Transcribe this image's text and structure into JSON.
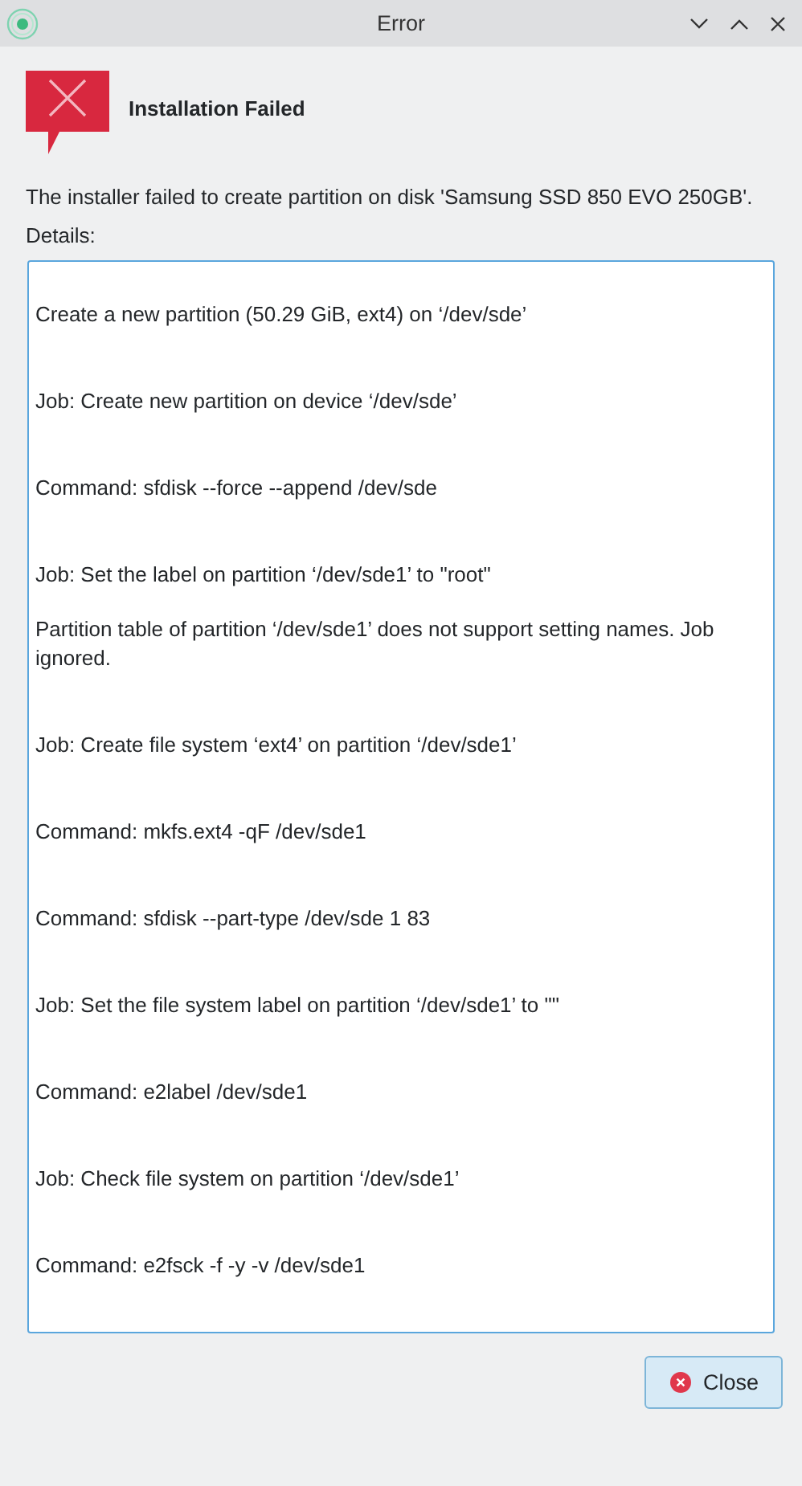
{
  "window": {
    "title": "Error"
  },
  "heading": "Installation Failed",
  "message": "The installer failed to create partition on disk 'Samsung SSD 850 EVO 250GB'.",
  "details_label": "Details:",
  "details": [
    {
      "kind": "step",
      "text": "Create a new partition (50.29 GiB, ext4) on ‘/dev/sde’"
    },
    {
      "kind": "step",
      "text": "Job: Create new partition on device ‘/dev/sde’"
    },
    {
      "kind": "step",
      "text": "Command: sfdisk --force --append /dev/sde"
    },
    {
      "kind": "step",
      "text": "Job: Set the label on partition ‘/dev/sde1’ to \"root\""
    },
    {
      "kind": "note",
      "text": "Partition table of partition ‘/dev/sde1’ does not support setting names. Job ignored."
    },
    {
      "kind": "step",
      "text": "Job: Create file system ‘ext4’ on partition ‘/dev/sde1’"
    },
    {
      "kind": "step",
      "text": "Command: mkfs.ext4 -qF /dev/sde1"
    },
    {
      "kind": "step",
      "text": "Command: sfdisk --part-type /dev/sde 1 83"
    },
    {
      "kind": "step",
      "text": "Job: Set the file system label on partition ‘/dev/sde1’ to \"\""
    },
    {
      "kind": "step",
      "text": "Command: e2label /dev/sde1"
    },
    {
      "kind": "step",
      "text": "Job: Check file system on partition ‘/dev/sde1’"
    },
    {
      "kind": "step",
      "text": "Command: e2fsck -f -y -v /dev/sde1"
    }
  ],
  "buttons": [
    {
      "label": "Close"
    }
  ]
}
